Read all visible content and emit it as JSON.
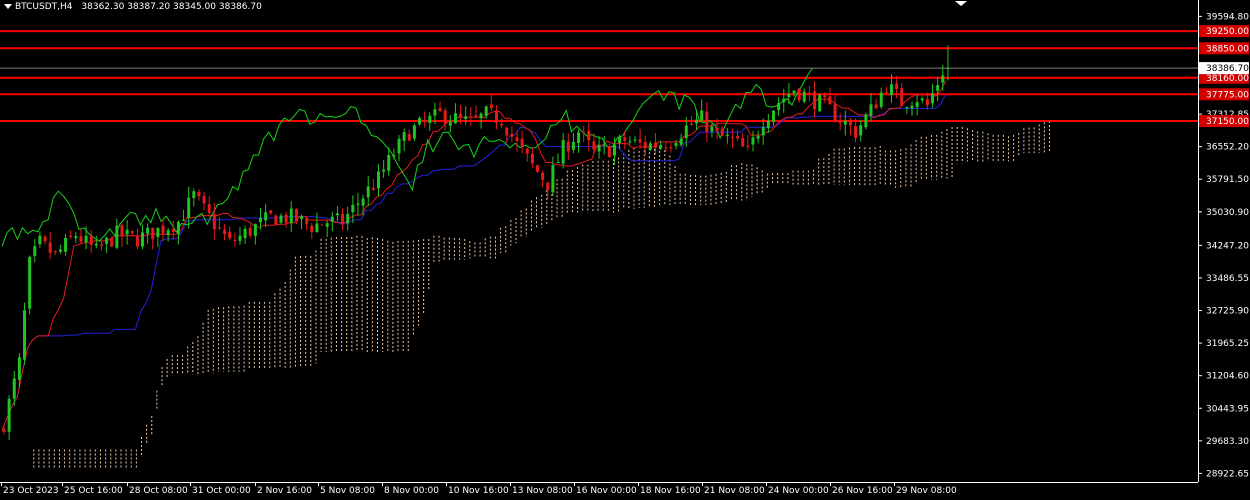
{
  "header": {
    "symbol": "BTCUSDT,H4",
    "open": "38362.30",
    "high": "38387.20",
    "low": "38345.00",
    "close": "38386.70"
  },
  "colors": {
    "background": "#000000",
    "axis": "#ffffff",
    "bull_candle": "#22c322",
    "bear_candle": "#e41b1b",
    "chikou": "#19d219",
    "tenkan": "#e41b1b",
    "kijun": "#2222dd",
    "cloud": "#f2c8a4",
    "level_line": "#ff0000",
    "level_box": "#d40000",
    "price_box": "#ffffff",
    "bid_line": "#808080"
  },
  "chart_data": {
    "type": "candlestick",
    "y_ticks": [
      "39594.80",
      "38850.00",
      "38160.00",
      "37775.00",
      "37312.85",
      "37150.00",
      "36552.20",
      "35791.50",
      "35030.90",
      "34247.20",
      "33486.55",
      "32725.90",
      "31965.25",
      "31204.60",
      "30443.95",
      "29683.30",
      "28922.65"
    ],
    "ylim": [
      28722,
      39790
    ],
    "x_ticks": [
      "23 Oct 2023",
      "25 Oct 16:00",
      "28 Oct 08:00",
      "31 Oct 00:00",
      "2 Nov 16:00",
      "5 Nov 08:00",
      "8 Nov 00:00",
      "10 Nov 16:00",
      "13 Nov 08:00",
      "16 Nov 00:00",
      "18 Nov 16:00",
      "21 Nov 08:00",
      "24 Nov 00:00",
      "26 Nov 16:00",
      "29 Nov 08:00"
    ],
    "levels": [
      {
        "label": "39250.00",
        "value": 39250
      },
      {
        "label": "38850.00",
        "value": 38850
      },
      {
        "label": "38160.00",
        "value": 38160
      },
      {
        "label": "37775.00",
        "value": 37775
      },
      {
        "label": "37150.00",
        "value": 37150
      }
    ],
    "current_price": {
      "label": "38386.70",
      "value": 38386.7
    },
    "anchors": [
      [
        0,
        30100
      ],
      [
        3,
        31500
      ],
      [
        5,
        33800
      ],
      [
        7,
        34300
      ],
      [
        10,
        34000
      ],
      [
        14,
        34500
      ],
      [
        18,
        34100
      ],
      [
        22,
        34500
      ],
      [
        26,
        34400
      ],
      [
        30,
        34600
      ],
      [
        34,
        34800
      ],
      [
        37,
        35400
      ],
      [
        40,
        34900
      ],
      [
        44,
        34300
      ],
      [
        48,
        34600
      ],
      [
        52,
        34900
      ],
      [
        56,
        34900
      ],
      [
        60,
        34700
      ],
      [
        63,
        34800
      ],
      [
        66,
        34800
      ],
      [
        70,
        35400
      ],
      [
        73,
        35800
      ],
      [
        76,
        36400
      ],
      [
        79,
        36900
      ],
      [
        82,
        37100
      ],
      [
        85,
        37300
      ],
      [
        88,
        37200
      ],
      [
        91,
        37100
      ],
      [
        94,
        37300
      ],
      [
        97,
        37200
      ],
      [
        100,
        36600
      ],
      [
        103,
        36100
      ],
      [
        106,
        35700
      ],
      [
        109,
        36500
      ],
      [
        112,
        36900
      ],
      [
        115,
        36400
      ],
      [
        118,
        36500
      ],
      [
        121,
        36700
      ],
      [
        124,
        36600
      ],
      [
        127,
        36600
      ],
      [
        130,
        36700
      ],
      [
        133,
        37000
      ],
      [
        136,
        37200
      ],
      [
        139,
        36800
      ],
      [
        142,
        36700
      ],
      [
        145,
        36400
      ],
      [
        148,
        37200
      ],
      [
        151,
        37600
      ],
      [
        154,
        37900
      ],
      [
        157,
        37700
      ],
      [
        160,
        37500
      ],
      [
        163,
        37200
      ],
      [
        166,
        36900
      ],
      [
        169,
        37400
      ],
      [
        172,
        38000
      ],
      [
        175,
        37600
      ],
      [
        178,
        37700
      ],
      [
        180,
        37500
      ],
      [
        182,
        38050
      ],
      [
        184,
        38600
      ]
    ],
    "candle_count": 185
  }
}
